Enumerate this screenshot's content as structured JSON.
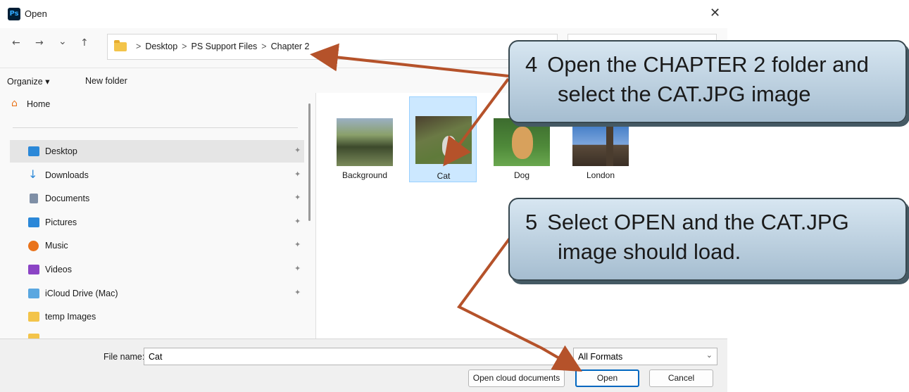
{
  "window": {
    "title": "Open",
    "app_icon": "Ps",
    "close_glyph": "✕"
  },
  "nav": {
    "back": "←",
    "forward": "→",
    "recent": "⌄",
    "up": "↑",
    "breadcrumb": [
      "Desktop",
      "PS Support Files",
      "Chapter 2"
    ],
    "separator": ">"
  },
  "toolbar": {
    "organize": "Organize ▾",
    "new_folder": "New folder"
  },
  "sidebar": {
    "home": "Home",
    "items": [
      {
        "label": "Desktop",
        "icon": "desktop-icon",
        "color": "#2b88d8",
        "pinned": true,
        "selected": true
      },
      {
        "label": "Downloads",
        "icon": "download-icon",
        "color": "#2b88d8",
        "pinned": true
      },
      {
        "label": "Documents",
        "icon": "document-icon",
        "color": "#7f8fa6",
        "pinned": true
      },
      {
        "label": "Pictures",
        "icon": "pictures-icon",
        "color": "#2b88d8",
        "pinned": true
      },
      {
        "label": "Music",
        "icon": "music-icon",
        "color": "#e9731b",
        "pinned": true
      },
      {
        "label": "Videos",
        "icon": "videos-icon",
        "color": "#8b44c5",
        "pinned": true
      },
      {
        "label": "iCloud Drive (Mac)",
        "icon": "cloud-drive-icon",
        "color": "#2b88d8",
        "pinned": true
      },
      {
        "label": "temp Images",
        "icon": "folder-icon",
        "color": "#f3c44a",
        "pinned": false
      }
    ],
    "pin_glyph": "✦"
  },
  "files": [
    {
      "name": "Background",
      "colors": [
        "#7a8a5a",
        "#3d4a2c",
        "#9bb0c4"
      ],
      "selected": false
    },
    {
      "name": "Cat",
      "colors": [
        "#6b7a45",
        "#4a3f2e",
        "#d9d9d4"
      ],
      "selected": true
    },
    {
      "name": "Dog",
      "colors": [
        "#4f8a3a",
        "#3c6b2e",
        "#d8a15c"
      ],
      "selected": false
    },
    {
      "name": "London",
      "colors": [
        "#2f6fc0",
        "#7da6dc",
        "#5a4a3a"
      ],
      "selected": false
    }
  ],
  "footer": {
    "file_name_label": "File name:",
    "file_name_value": "Cat",
    "format": "All Formats",
    "cloud_button": "Open cloud documents",
    "open_button": "Open",
    "cancel_button": "Cancel"
  },
  "callouts": {
    "step4": {
      "number": "4",
      "line1": "Open the CHAPTER 2 folder and",
      "line2": "select the CAT.JPG image"
    },
    "step5": {
      "number": "5",
      "line1": "Select OPEN and the CAT.JPG",
      "line2": "image should load."
    }
  },
  "colors": {
    "accent": "#0067c0",
    "arrow": "#b5522a",
    "selection": "#cce8ff"
  }
}
